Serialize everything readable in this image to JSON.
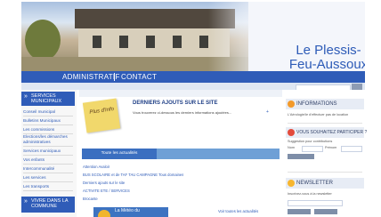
{
  "header": {
    "town_name_line1": "Le Plessis-",
    "town_name_line2": "Feu-Aussoux",
    "photo_icon": "town-hall-photo"
  },
  "nav": {
    "items": [
      "ADMINISTRATIF",
      "CONTACT"
    ]
  },
  "sidebar": {
    "section1": "SERVICES MUNICIPAUX",
    "items": [
      "Conseil municipal",
      "Bulletins Municipaux",
      "Les commissions",
      "Elections/les démarches administratives",
      "Services municipaux",
      "Vos enfants",
      "Intercommunalité",
      "Les services",
      "Les transports"
    ],
    "section2": "VIVRE DANS LA COMMUNE"
  },
  "main": {
    "postit_label": "Plus d'Info",
    "latest_title": "DERNIERS AJOUTS SUR LE SITE",
    "latest_text": "Vous trouverez ci-dessous les derniers informations ajoutées...",
    "latest_more": "+",
    "tabs": [
      "Toute les actualités",
      "",
      ""
    ],
    "news": [
      "Attention Avaloir",
      "BUS SCOLAIRE et de TAF TAU CAMPAGNE Tous domaines",
      "Derniers ajouts sur le site",
      "ACTIVITE ETE / SERVICES",
      "Brocante"
    ],
    "promo_label": "La Météo du",
    "more_news": "Voir toutes les actualités"
  },
  "right": {
    "info_title": "INFORMATIONS",
    "info_text": "L'Aérologie/Ie d'effectuer pas de location",
    "participate_title": "VOUS SOUHAITEZ PARTICIPER ?",
    "participate_text": "Suggestion pour contributions",
    "participate_label1": "Nom",
    "participate_label2": "Prénom",
    "newsletter_title": "NEWSLETTER",
    "newsletter_text": "Inscrivez-vous à la newsletter",
    "colors": {
      "accent": "#2f5cb8",
      "info_icon": "#f39a2a",
      "participate_icon": "#e34a3b",
      "newsletter_icon": "#f7b62f"
    }
  }
}
